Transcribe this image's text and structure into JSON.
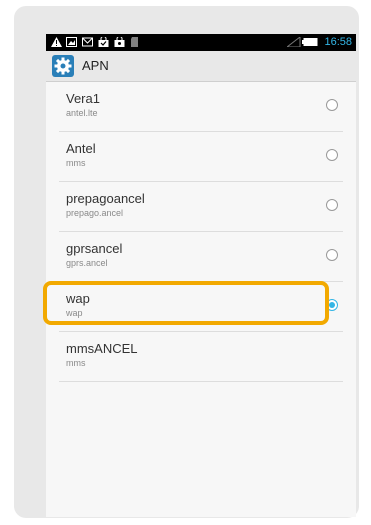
{
  "status_bar": {
    "time": "16:58",
    "icons": [
      "warning-icon",
      "image-icon",
      "mail-icon",
      "shopping-bag-check-icon",
      "shopping-bag-icon",
      "sd-card-icon",
      "signal-icon",
      "battery-icon"
    ]
  },
  "action_bar": {
    "icon": "settings-gear-icon",
    "title": "APN"
  },
  "apns": [
    {
      "name": "Vera1",
      "apn": "antel.lte",
      "selected": false,
      "has_radio": true
    },
    {
      "name": "Antel",
      "apn": "mms",
      "selected": false,
      "has_radio": true
    },
    {
      "name": "prepagoancel",
      "apn": "prepago.ancel",
      "selected": false,
      "has_radio": true
    },
    {
      "name": "gprsancel",
      "apn": "gprs.ancel",
      "selected": false,
      "has_radio": true
    },
    {
      "name": "wap",
      "apn": "wap",
      "selected": true,
      "has_radio": true
    },
    {
      "name": "mmsANCEL",
      "apn": "mms",
      "selected": false,
      "has_radio": false
    }
  ],
  "colors": {
    "accent": "#33b5e5",
    "highlight": "#f2a900"
  }
}
